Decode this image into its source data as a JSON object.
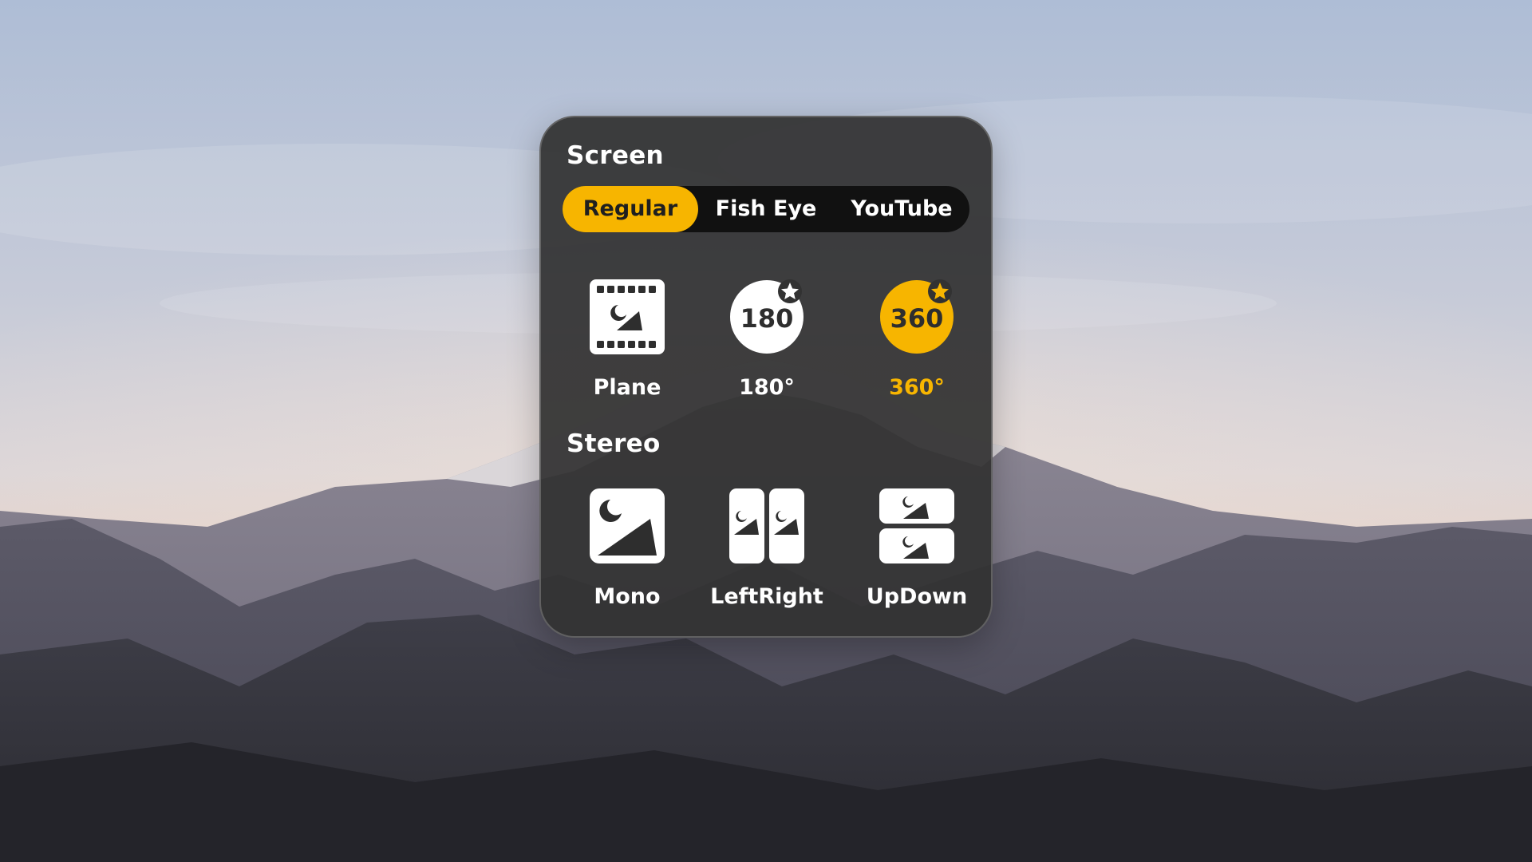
{
  "colors": {
    "accent": "#F7B500",
    "panel": "#323232",
    "segment_track": "#111111",
    "text": "#FFFFFF"
  },
  "screen": {
    "title": "Screen",
    "modes": [
      {
        "label": "Regular",
        "selected": true
      },
      {
        "label": "Fish Eye",
        "selected": false
      },
      {
        "label": "YouTube",
        "selected": false
      }
    ],
    "options": [
      {
        "label": "Plane",
        "icon": "film-frame-icon",
        "selected": false
      },
      {
        "label": "180°",
        "icon": "180-badge-icon",
        "badge_text": "180",
        "selected": false
      },
      {
        "label": "360°",
        "icon": "360-badge-icon",
        "badge_text": "360",
        "selected": true
      }
    ]
  },
  "stereo": {
    "title": "Stereo",
    "options": [
      {
        "label": "Mono",
        "icon": "single-image-icon",
        "selected": false
      },
      {
        "label": "LeftRight",
        "icon": "side-by-side-icon",
        "selected": false
      },
      {
        "label": "UpDown",
        "icon": "top-bottom-icon",
        "selected": false
      }
    ]
  }
}
